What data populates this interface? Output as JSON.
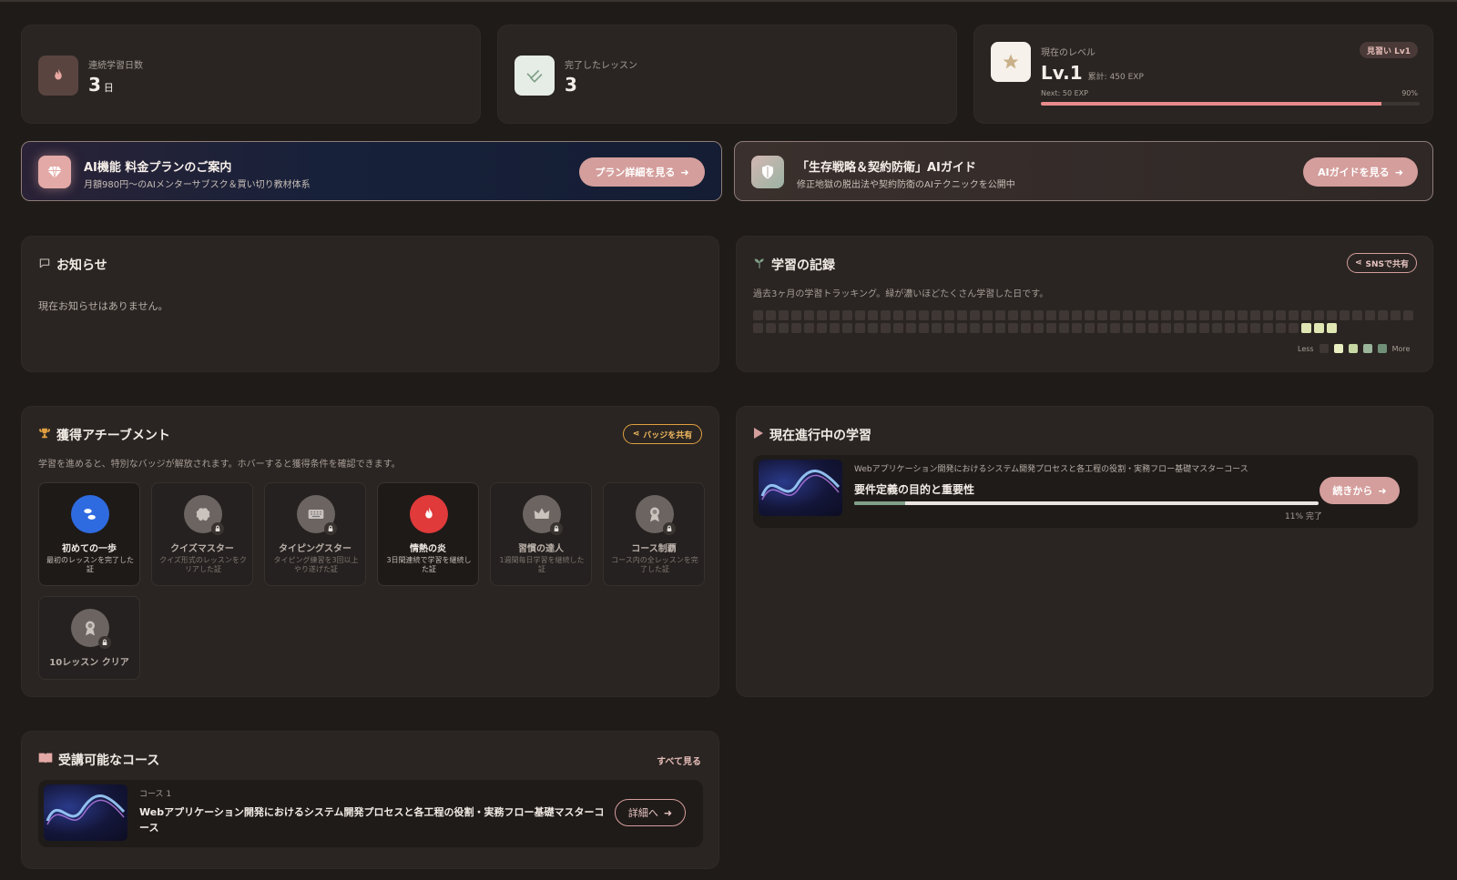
{
  "stats": {
    "streak": {
      "label": "連続学習日数",
      "value": "3",
      "unit": "日",
      "icon": "flame-icon"
    },
    "lessons": {
      "label": "完了したレッスン",
      "value": "3",
      "icon": "check-icon"
    },
    "level": {
      "label": "現在のレベル",
      "value": "Lv.1",
      "total_exp": "累計: 450 EXP",
      "next": "Next: 50 EXP",
      "percent_label": "90%",
      "progress": 0.9,
      "badge": "見習い Lv1",
      "icon": "star-icon"
    }
  },
  "banners": {
    "plan": {
      "title": "AI機能 料金プランのご案内",
      "subtitle": "月額980円〜のAIメンターサブスク＆買い切り教材体系",
      "button": "プラン詳細を見る"
    },
    "guide": {
      "title": "「生存戦略＆契約防衛」AIガイド",
      "subtitle": "修正地獄の脱出法や契約防衛のAIテクニックを公開中",
      "button": "AIガイドを見る"
    }
  },
  "news": {
    "title": "お知らせ",
    "empty": "現在お知らせはありません。"
  },
  "record": {
    "title": "学習の記録",
    "share": "SNSで共有",
    "description": "過去3ヶ月の学習トラッキング。緑が濃いほどたくさん学習した日です。",
    "legend_less": "Less",
    "legend_more": "More",
    "active_days": 3
  },
  "achievements": {
    "title": "獲得アチーブメント",
    "share": "バッジを共有",
    "description": "学習を進めると、特別なバッジが解放されます。ホバーすると獲得条件を確認できます。",
    "badges": [
      {
        "name": "初めての一歩",
        "desc": "最初のレッスンを完了した証",
        "unlocked": true,
        "icon": "footsteps-icon",
        "color": "#2f6be0"
      },
      {
        "name": "クイズマスター",
        "desc": "クイズ形式のレッスンをクリアした証",
        "unlocked": false,
        "icon": "brain-icon"
      },
      {
        "name": "タイピングスター",
        "desc": "タイピング練習を3回以上やり遂げた証",
        "unlocked": false,
        "icon": "keyboard-icon"
      },
      {
        "name": "情熱の炎",
        "desc": "3日間連続で学習を継続した証",
        "unlocked": true,
        "icon": "flame-icon",
        "color": "#e03a3a"
      },
      {
        "name": "習慣の達人",
        "desc": "1週間毎日学習を継続した証",
        "unlocked": false,
        "icon": "crown-icon"
      },
      {
        "name": "コース制覇",
        "desc": "コース内の全レッスンを完了した証",
        "unlocked": false,
        "icon": "award-icon"
      },
      {
        "name": "10レッスン クリア",
        "desc": "",
        "unlocked": false,
        "icon": "award-icon"
      }
    ]
  },
  "current": {
    "title": "現在進行中の学習",
    "course": "Webアプリケーション開発におけるシステム開発プロセスと各工程の役割・実務フロー基礎マスターコース",
    "lesson": "要件定義の目的と重要性",
    "progress": 0.11,
    "progress_label": "11% 完了",
    "button": "続きから"
  },
  "courses": {
    "title": "受講可能なコース",
    "see_all": "すべて見る",
    "items": [
      {
        "index": "コース 1",
        "name": "Webアプリケーション開発におけるシステム開発プロセスと各工程の役割・実務フロー基礎マスターコース",
        "button": "詳細へ"
      }
    ]
  },
  "colors": {
    "accent": "#d49e9c",
    "heat_on": "#dfe6b3",
    "heat_off": "#3e3734",
    "progress": "#7fa088",
    "gold": "#e0a040"
  }
}
